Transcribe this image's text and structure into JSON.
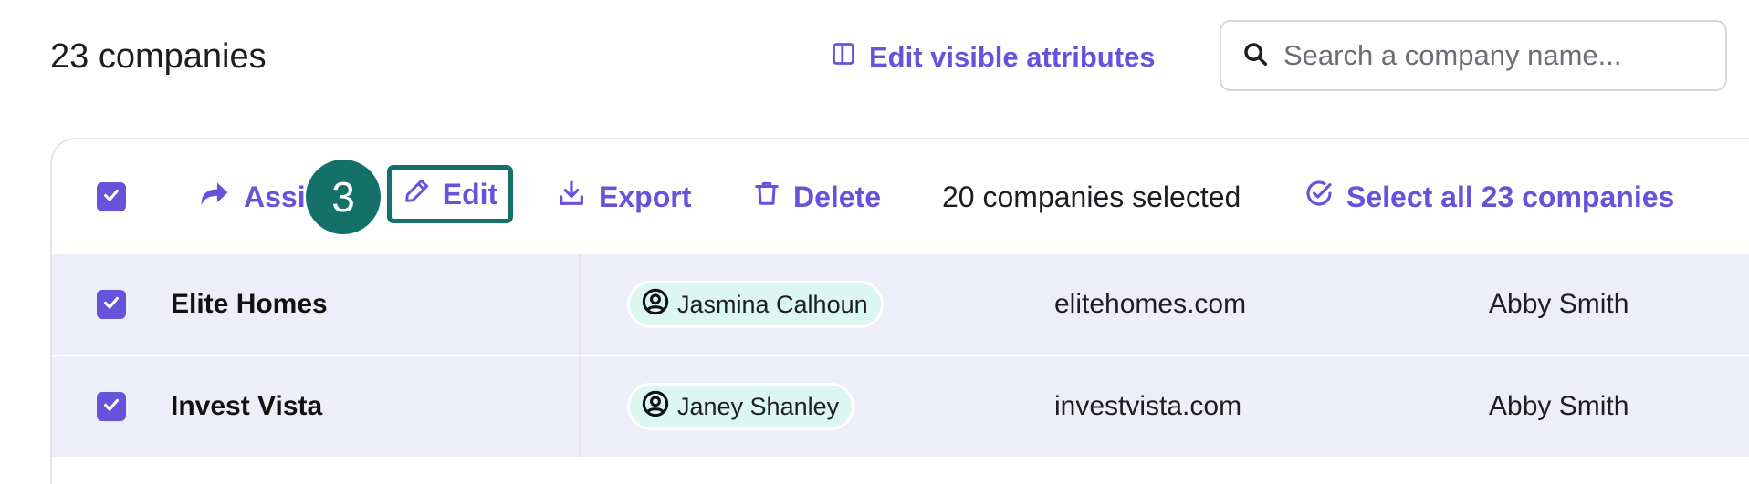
{
  "header": {
    "title": "23 companies",
    "edit_attributes_label": "Edit visible attributes",
    "search_placeholder": "Search a company name..."
  },
  "toolbar": {
    "assign_label": "Assi",
    "edit_label": "Edit",
    "export_label": "Export",
    "delete_label": "Delete",
    "selection_status": "20 companies selected",
    "select_all_label": "Select all 23 companies",
    "step_badge": "3"
  },
  "rows": [
    {
      "name": "Elite Homes",
      "owner": "Jasmina Calhoun",
      "domain": "elitehomes.com",
      "user": "Abby Smith",
      "selected": true
    },
    {
      "name": "Invest Vista",
      "owner": "Janey Shanley",
      "domain": "investvista.com",
      "user": "Abby Smith",
      "selected": true
    }
  ],
  "colors": {
    "accent": "#6753db",
    "highlight": "#14716a",
    "row_selected_bg": "#eeedfa",
    "owner_pill_bg": "#dcf7f1"
  },
  "icons": {
    "edit_attributes": "columns-icon",
    "search": "search-icon",
    "assign": "share-arrow-icon",
    "edit": "pencil-icon",
    "export": "download-icon",
    "delete": "trash-icon",
    "select_all": "check-circle-icon",
    "owner": "user-circle-icon",
    "checkbox": "checkmark-icon"
  }
}
